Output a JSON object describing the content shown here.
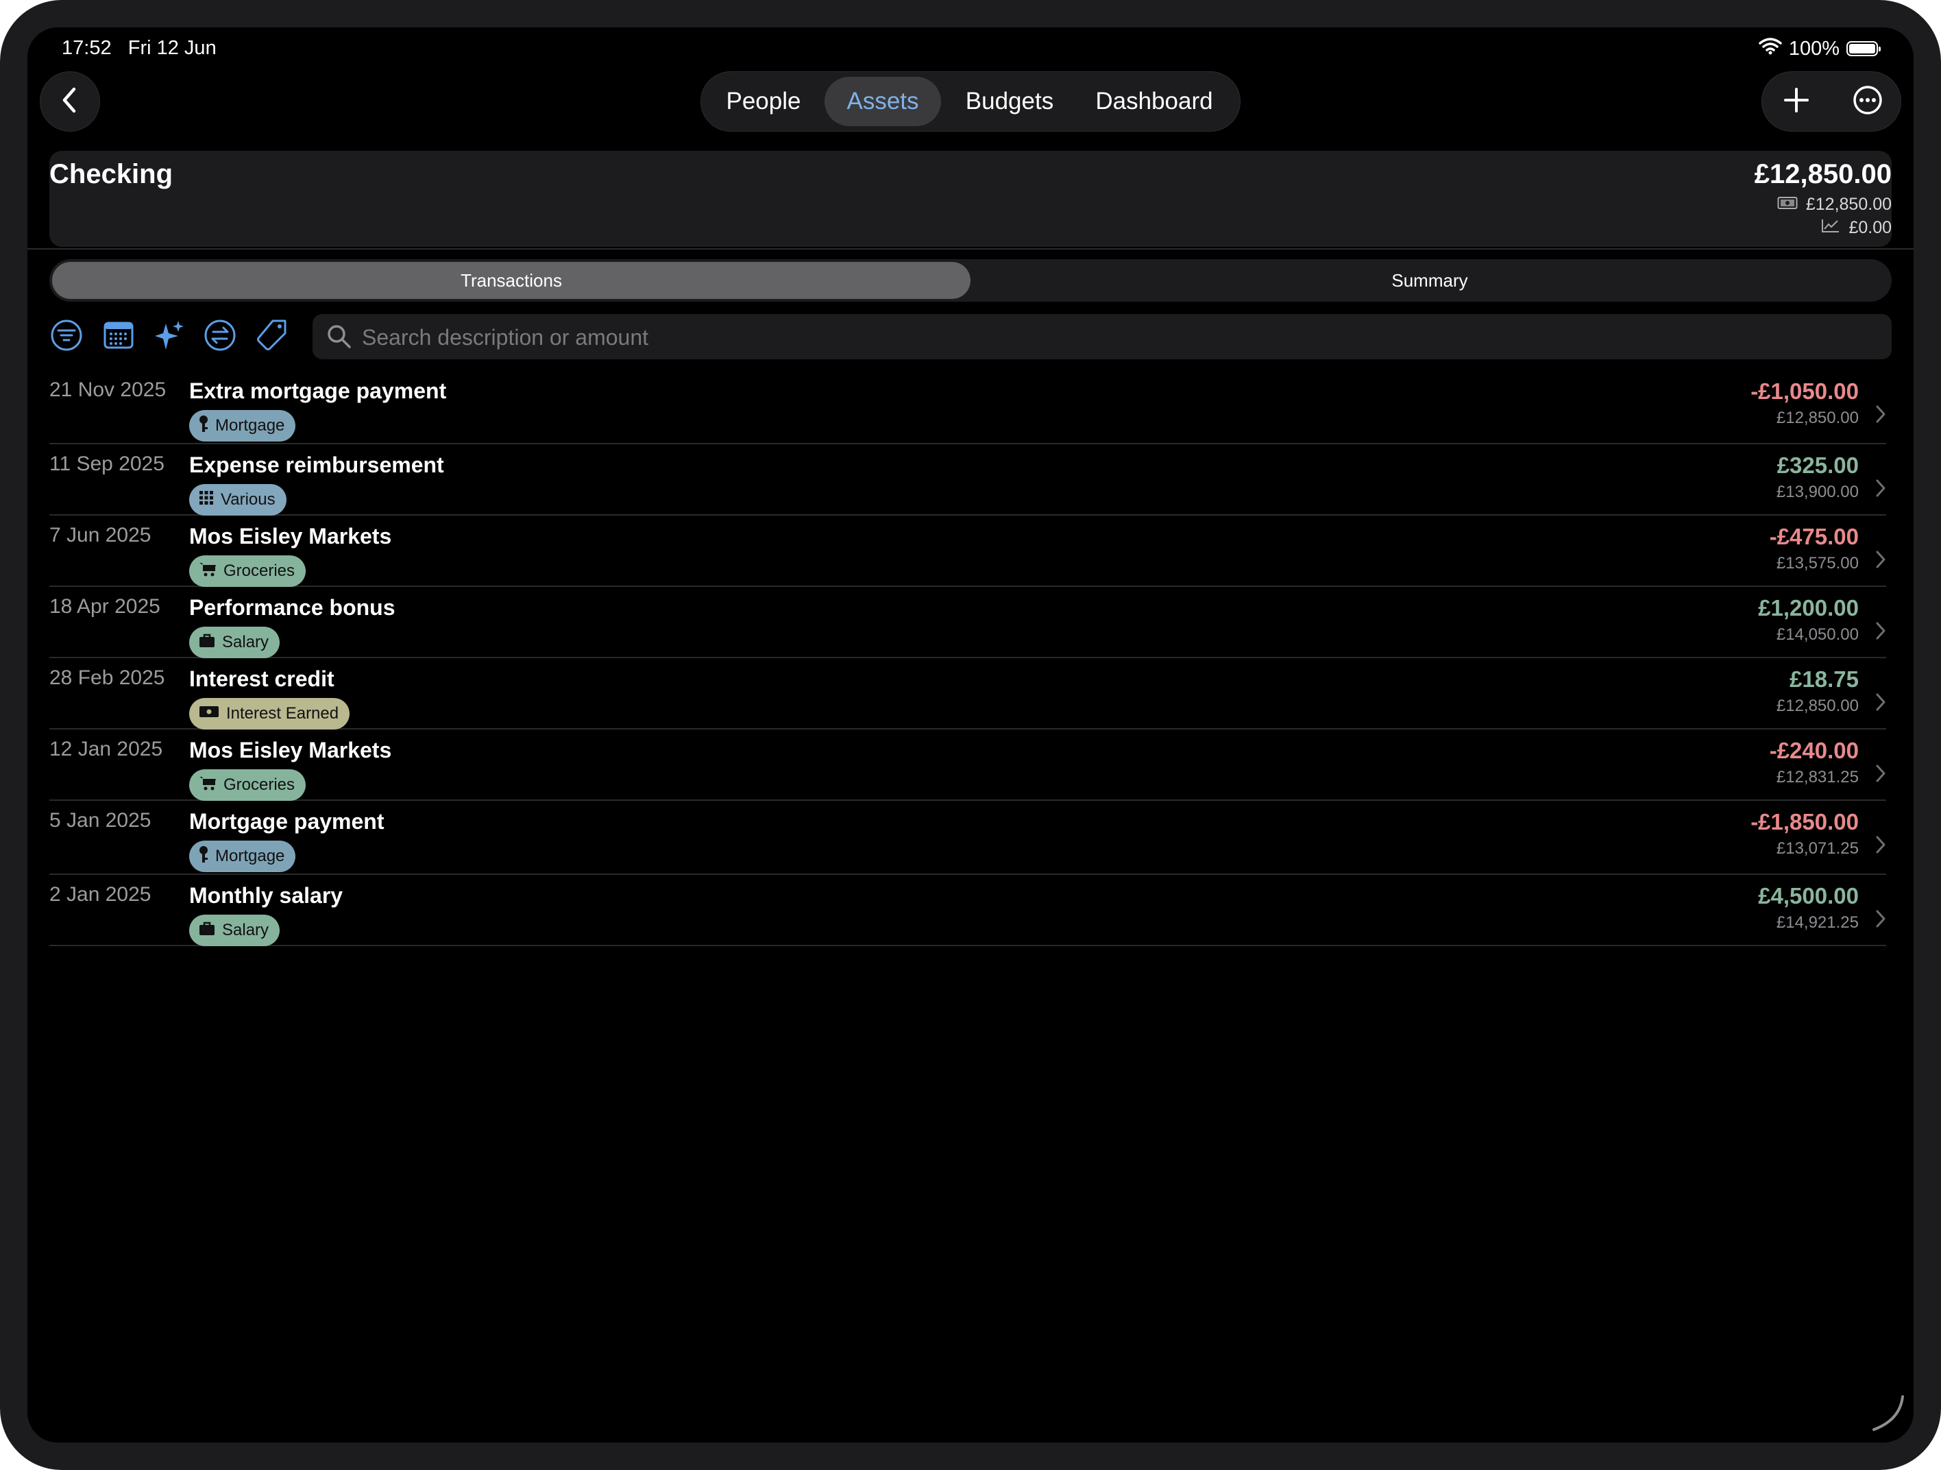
{
  "status_bar": {
    "time": "17:52",
    "date": "Fri 12 Jun",
    "battery": "100%"
  },
  "nav": {
    "tabs": [
      {
        "label": "People"
      },
      {
        "label": "Assets"
      },
      {
        "label": "Budgets"
      },
      {
        "label": "Dashboard"
      }
    ],
    "active_tab": "Assets"
  },
  "account": {
    "name": "Checking",
    "total": "£12,850.00",
    "cash_value": "£12,850.00",
    "investment_value": "£0.00"
  },
  "segments": {
    "transactions": "Transactions",
    "summary": "Summary",
    "active": "Transactions"
  },
  "search": {
    "placeholder": "Search description or amount",
    "value": ""
  },
  "transactions": [
    {
      "date": "21 Nov 2025",
      "description": "Extra mortgage payment",
      "tag": "Mortgage",
      "tag_icon": "key-icon",
      "amount": "-£1,050.00",
      "balance": "£12,850.00",
      "type": "neg"
    },
    {
      "date": "11 Sep 2025",
      "description": "Expense reimbursement",
      "tag": "Various",
      "tag_icon": "grid-icon",
      "amount": "£325.00",
      "balance": "£13,900.00",
      "type": "pos"
    },
    {
      "date": "7 Jun 2025",
      "description": "Mos Eisley Markets",
      "tag": "Groceries",
      "tag_icon": "cart-icon",
      "amount": "-£475.00",
      "balance": "£13,575.00",
      "type": "neg"
    },
    {
      "date": "18 Apr 2025",
      "description": "Performance bonus",
      "tag": "Salary",
      "tag_icon": "briefcase-icon",
      "amount": "£1,200.00",
      "balance": "£14,050.00",
      "type": "pos"
    },
    {
      "date": "28 Feb 2025",
      "description": "Interest credit",
      "tag": "Interest Earned",
      "tag_icon": "banknote-icon",
      "amount": "£18.75",
      "balance": "£12,850.00",
      "type": "pos"
    },
    {
      "date": "12 Jan 2025",
      "description": "Mos Eisley Markets",
      "tag": "Groceries",
      "tag_icon": "cart-icon",
      "amount": "-£240.00",
      "balance": "£12,831.25",
      "type": "neg"
    },
    {
      "date": "5 Jan 2025",
      "description": "Mortgage payment",
      "tag": "Mortgage",
      "tag_icon": "key-icon",
      "amount": "-£1,850.00",
      "balance": "£13,071.25",
      "type": "neg"
    },
    {
      "date": "2 Jan 2025",
      "description": "Monthly salary",
      "tag": "Salary",
      "tag_icon": "briefcase-icon",
      "amount": "£4,500.00",
      "balance": "£14,921.25",
      "type": "pos"
    }
  ],
  "colors": {
    "accent": "#7fb2e8",
    "negative": "#e8898c",
    "positive": "#8ab59e",
    "tag_mortgage": "#7fa3b6",
    "tag_various": "#82a6bc",
    "tag_groceries": "#86b39c",
    "tag_salary": "#86b39c",
    "tag_interest": "#b9b88f"
  }
}
